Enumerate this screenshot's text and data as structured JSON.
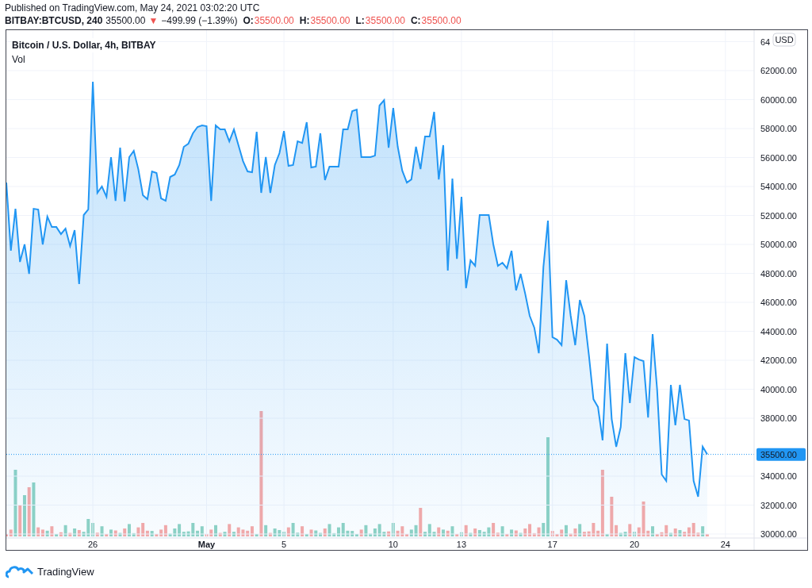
{
  "header": {
    "published": "Published on TradingView.com, May 24, 2021 03:02:20 UTC",
    "symbol": "BITBAY:BTCUSD, 240",
    "last": "35500.00",
    "change_arrow": "▼",
    "change": "−499.99 (−1.39%)",
    "ohlc": [
      {
        "label": "O:",
        "value": "35500.00"
      },
      {
        "label": "H:",
        "value": "35500.00"
      },
      {
        "label": "L:",
        "value": "35500.00"
      },
      {
        "label": "C:",
        "value": "35500.00"
      }
    ]
  },
  "legend": {
    "title": "Bitcoin / U.S. Dollar, 4h, BITBAY",
    "indicator": "Vol"
  },
  "chart": {
    "currency": "USD",
    "price_label": "35500.00",
    "top_tick_fragment": "64",
    "chart_data": {
      "type": "area",
      "grid": true,
      "ylim": [
        29726,
        64795
      ],
      "categories": [
        null,
        null,
        null,
        null,
        null,
        null,
        null,
        null,
        null,
        null,
        null,
        null,
        null,
        null,
        null,
        null,
        null,
        null,
        null,
        "26",
        null,
        null,
        null,
        null,
        null,
        null,
        null,
        null,
        null,
        null,
        null,
        null,
        null,
        null,
        null,
        null,
        null,
        null,
        null,
        null,
        null,
        null,
        null,
        null,
        "May",
        null,
        null,
        null,
        null,
        null,
        null,
        null,
        null,
        null,
        null,
        null,
        null,
        null,
        null,
        null,
        null,
        "5",
        null,
        null,
        null,
        null,
        null,
        null,
        null,
        null,
        null,
        null,
        null,
        null,
        null,
        null,
        null,
        null,
        null,
        null,
        null,
        null,
        null,
        null,
        null,
        "10",
        null,
        null,
        null,
        null,
        null,
        null,
        null,
        null,
        null,
        null,
        null,
        null,
        null,
        null,
        "13",
        null,
        null,
        null,
        null,
        null,
        null,
        null,
        null,
        null,
        null,
        null,
        null,
        null,
        null,
        null,
        null,
        null,
        null,
        null,
        "17",
        null,
        null,
        null,
        null,
        null,
        null,
        null,
        null,
        null,
        null,
        null,
        null,
        null,
        null,
        null,
        null,
        null,
        "20",
        null,
        null,
        null,
        null,
        null,
        null,
        null,
        null,
        null,
        null,
        null,
        null,
        null,
        null,
        null,
        null,
        null,
        null,
        null,
        "24",
        null,
        null,
        null,
        null,
        null,
        null
      ],
      "yticks": [
        {
          "value": 30000,
          "label": "30000.00"
        },
        {
          "value": 32000,
          "label": "32000.00"
        },
        {
          "value": 34000,
          "label": "34000.00"
        },
        {
          "value": 38000,
          "label": "38000.00"
        },
        {
          "value": 40000,
          "label": "40000.00"
        },
        {
          "value": 42000,
          "label": "42000.00"
        },
        {
          "value": 44000,
          "label": "44000.00"
        },
        {
          "value": 46000,
          "label": "46000.00"
        },
        {
          "value": 48000,
          "label": "48000.00"
        },
        {
          "value": 50000,
          "label": "50000.00"
        },
        {
          "value": 52000,
          "label": "52000.00"
        },
        {
          "value": 54000,
          "label": "54000.00"
        },
        {
          "value": 56000,
          "label": "56000.00"
        },
        {
          "value": 58000,
          "label": "58000.00"
        },
        {
          "value": 60000,
          "label": "60000.00"
        },
        {
          "value": 62000,
          "label": "62000.00"
        }
      ],
      "series": [
        {
          "color": "#2196f3",
          "values": [
            54270,
            49560,
            52460,
            48790,
            50000,
            47970,
            52460,
            52410,
            50000,
            51920,
            51200,
            51200,
            50710,
            51090,
            49890,
            50980,
            47260,
            52030,
            52410,
            61230,
            53560,
            54000,
            53290,
            56030,
            53010,
            56680,
            52960,
            56030,
            56460,
            55200,
            53400,
            53120,
            55040,
            54930,
            53180,
            53010,
            54660,
            54820,
            55480,
            56740,
            56960,
            57670,
            58110,
            58220,
            58160,
            53010,
            58220,
            57940,
            57940,
            57120,
            57940,
            56850,
            55750,
            55040,
            54980,
            57780,
            53560,
            56030,
            53560,
            55480,
            56300,
            57830,
            55420,
            55480,
            57120,
            57010,
            58440,
            55310,
            55370,
            57670,
            54440,
            55370,
            55370,
            55370,
            57940,
            57940,
            59200,
            59310,
            56030,
            56030,
            56030,
            56130,
            59590,
            59970,
            56680,
            59420,
            56740,
            55090,
            54270,
            54490,
            56740,
            55200,
            57450,
            57450,
            59150,
            54490,
            56850,
            48190,
            54550,
            49010,
            53290,
            46980,
            48900,
            48520,
            52030,
            52030,
            52030,
            50000,
            48520,
            48740,
            48350,
            49560,
            46820,
            47970,
            46600,
            45070,
            44250,
            42490,
            48460,
            51640,
            43590,
            43420,
            43040,
            47530,
            45070,
            43040,
            46160,
            45070,
            42330,
            39310,
            38770,
            36470,
            43150,
            37940,
            36030,
            37400,
            42490,
            39040,
            42220,
            42050,
            41940,
            38050,
            43810,
            39970,
            34110,
            33670,
            40300,
            37510,
            40300,
            37940,
            37840,
            33670,
            32580,
            36030,
            35500,
            null,
            null,
            null,
            null,
            null,
            null,
            null,
            null,
            null,
            null
          ]
        }
      ]
    }
  },
  "footer": {
    "brand": "TradingView"
  }
}
